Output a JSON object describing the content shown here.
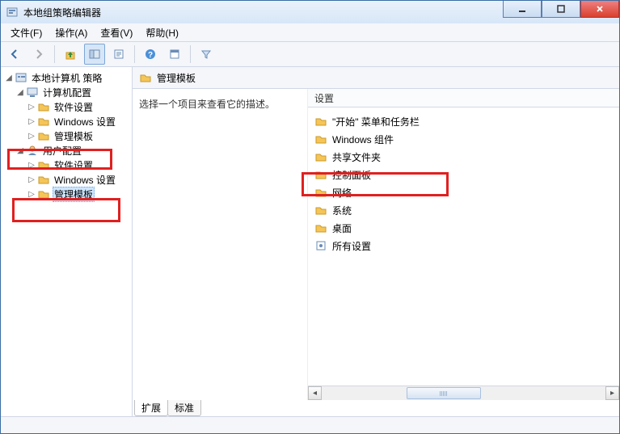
{
  "window": {
    "title": "本地组策略编辑器"
  },
  "menu": {
    "file": "文件(F)",
    "action": "操作(A)",
    "view": "查看(V)",
    "help": "帮助(H)"
  },
  "tree": {
    "root": "本地计算机 策略",
    "computer": "计算机配置",
    "software1": "软件设置",
    "windows1": "Windows 设置",
    "admintpl1": "管理模板",
    "user": "用户配置",
    "software2": "软件设置",
    "windows2": "Windows 设置",
    "admintpl2": "管理模板"
  },
  "header": {
    "title": "管理模板"
  },
  "desc": {
    "prompt": "选择一个项目来查看它的描述。"
  },
  "col": {
    "setting": "设置"
  },
  "items": {
    "start_menu": "\"开始\" 菜单和任务栏",
    "windows_comp": "Windows 组件",
    "shared_folders": "共享文件夹",
    "control_panel": "控制面板",
    "network": "网络",
    "system": "系统",
    "desktop": "桌面",
    "all_settings": "所有设置"
  },
  "tabs": {
    "extended": "扩展",
    "standard": "标准"
  }
}
